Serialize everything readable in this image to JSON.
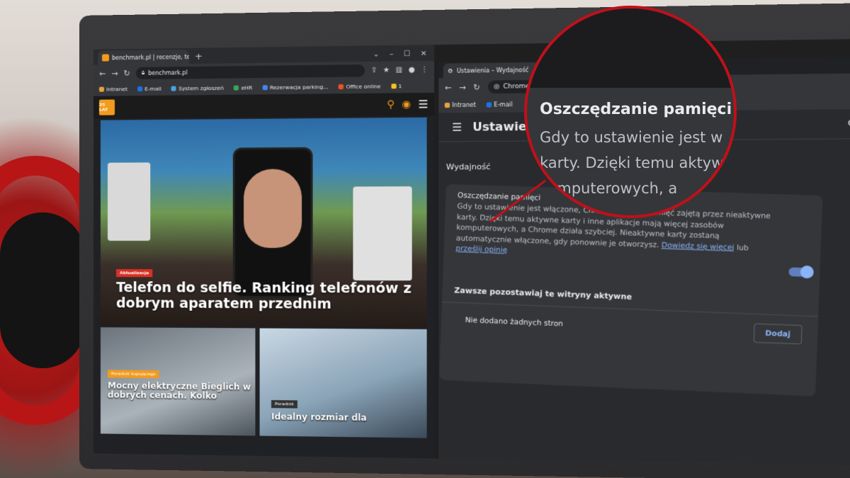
{
  "left_browser": {
    "tab_title": "benchmark.pl | recenzje, testy, n",
    "url": "benchmark.pl",
    "bookmarks": [
      "Intranet",
      "E-mail",
      "System zgłoszeń",
      "eHR",
      "Rezerwacja parking...",
      "Office online",
      "1"
    ],
    "site": {
      "logo_text": "25 LAT",
      "hero_badge": "Aktualizacja",
      "hero_title": "Telefon do selfie. Ranking telefonów z dobrym aparatem przednim",
      "card_a_badge": "Poradnik kupującego",
      "card_a_title": "Mocny elektryczne Bieglich w dobrych cenach. Kolko",
      "card_b_badge": "Poradnik",
      "card_b_title": "Idealny rozmiar dla"
    }
  },
  "right_browser": {
    "tab_title": "Ustawienia – Wydajność",
    "omnibox_text": "Chrome",
    "bookmarks": [
      "Intranet",
      "E-mail",
      "1"
    ],
    "settings_title": "Ustawienia",
    "section": "Wydajność",
    "memory_saver": {
      "name": "Oszczędzanie pamięci",
      "desc_part1": "Gdy to ustawienie jest włączone, Chrome zwalnia pamięć zajętą przez nieaktywne karty. Dzięki temu aktywne karty i inne aplikacje mają więcej zasobów komputerowych, a Chrome działa szybciej. Nieaktywne karty zostaną automatycznie włączone, gdy ponownie je otworzysz.",
      "learn_more": "Dowiedz się więcej",
      "or": "lub",
      "feedback": "prześlij opinię",
      "enabled": true
    },
    "always_active": {
      "heading": "Zawsze pozostawiaj te witryny aktywne",
      "empty_text": "Nie dodano żadnych stron",
      "add_button": "Dodaj"
    }
  },
  "magnifier": {
    "title": "Oszczędzanie pamięci",
    "line1": "Gdy to ustawienie jest w",
    "line2": "karty. Dzięki temu aktyw",
    "line3": "komputerowych, a"
  },
  "colors": {
    "callout_red": "#c0101a",
    "benchmark_orange": "#f29b1d",
    "chrome_link": "#8ab4f8"
  }
}
